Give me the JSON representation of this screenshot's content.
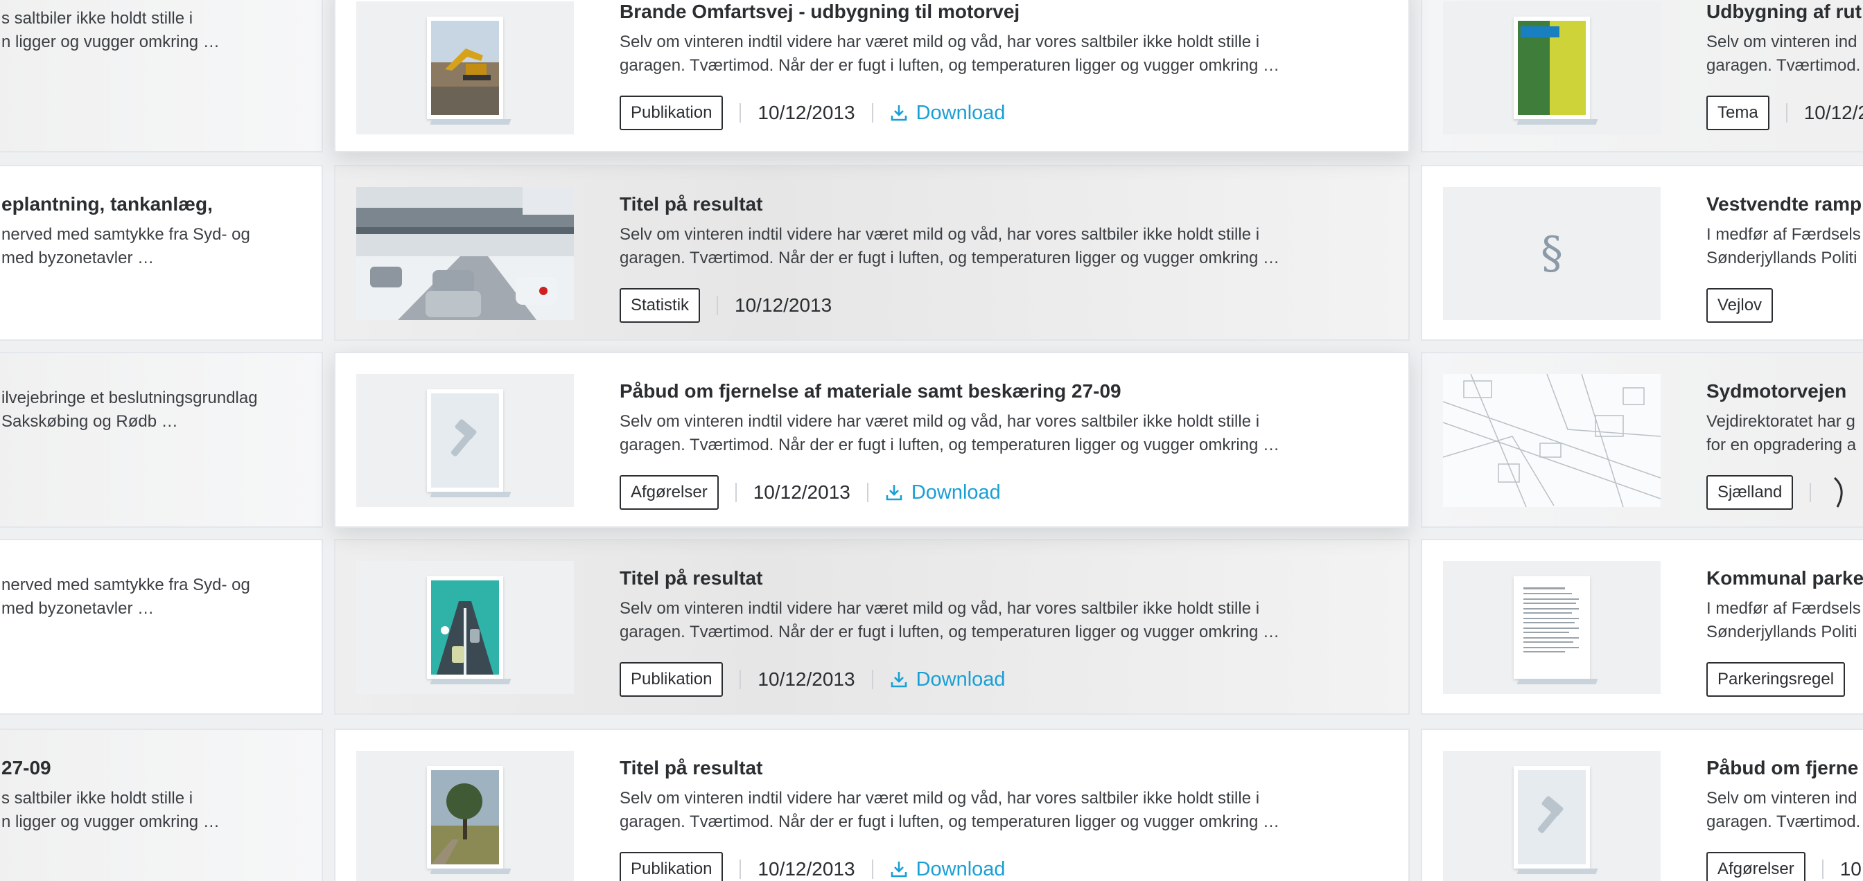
{
  "left_column": [
    {
      "title": "",
      "desc": [
        "s saltbiler ikke holdt stille i",
        "n ligger og vugger omkring …"
      ]
    },
    {
      "title": "eplantning, tankanlæg,",
      "desc": [
        "nerved med samtykke fra Syd- og",
        "med byzonetavler …"
      ]
    },
    {
      "title": "",
      "desc": [
        "ilvejebringe et beslutningsgrundlag",
        " Sakskøbing og Rødb …"
      ]
    },
    {
      "title": "",
      "desc": [
        "nerved med samtykke fra Syd- og",
        "med byzonetavler …"
      ]
    },
    {
      "title": " 27-09",
      "desc": [
        "s saltbiler ikke holdt stille i",
        "n ligger og vugger omkring …"
      ]
    }
  ],
  "center_column": [
    {
      "title": "Brande Omfartsvej - udbygning til motorvej",
      "desc": [
        "Selv om vinteren indtil videre har været mild og våd, har vores saltbiler ikke holdt stille i",
        "garagen. Tværtimod. Når der er fugt i luften, og temperaturen ligger og vugger omkring …"
      ],
      "tag": "Publikation",
      "date": "10/12/2013",
      "download": "Download",
      "thumb": "excavator-photo-icon"
    },
    {
      "title": "Titel på resultat",
      "desc": [
        "Selv om vinteren indtil videre har været mild og våd, har vores saltbiler ikke holdt stille i",
        "garagen. Tværtimod. Når der er fugt i luften, og temperaturen ligger og vugger omkring …"
      ],
      "tag": "Statistik",
      "date": "10/12/2013",
      "download": "",
      "thumb": "snowy-road-photo-icon"
    },
    {
      "title": "Påbud om fjernelse af materiale samt beskæring 27-09",
      "desc": [
        "Selv om vinteren indtil videre har været mild og våd, har vores saltbiler ikke holdt stille i",
        "garagen. Tværtimod. Når der er fugt i luften, og temperaturen ligger og vugger omkring …"
      ],
      "tag": "Afgørelser",
      "date": "10/12/2013",
      "download": "Download",
      "thumb": "gavel-icon"
    },
    {
      "title": "Titel på resultat",
      "desc": [
        "Selv om vinteren indtil videre har været mild og våd, har vores saltbiler ikke holdt stille i",
        "garagen. Tværtimod. Når der er fugt i luften, og temperaturen ligger og vugger omkring …"
      ],
      "tag": "Publikation",
      "date": "10/12/2013",
      "download": "Download",
      "thumb": "road-illustration-icon"
    },
    {
      "title": "Titel på resultat",
      "desc": [
        "Selv om vinteren indtil videre har været mild og våd, har vores saltbiler ikke holdt stille i",
        "garagen. Tværtimod. Når der er fugt i luften, og temperaturen ligger og vugger omkring …"
      ],
      "tag": "Publikation",
      "date": "10/12/2013",
      "download": "Download",
      "thumb": "tree-photo-icon"
    }
  ],
  "right_column": [
    {
      "title": "Udbygning af rut",
      "desc": [
        "Selv om vinteren ind",
        "garagen. Tværtimod."
      ],
      "tag": "Tema",
      "date": "10/12/2",
      "thumb": "field-map-icon"
    },
    {
      "title": "Vestvendte ramp",
      "desc": [
        "I medfør af Færdsels",
        "Sønderjyllands Politi"
      ],
      "tag": "Vejlov",
      "date": "",
      "thumb": "paragraph-icon",
      "para": "§"
    },
    {
      "title": "Sydmotorvejen",
      "desc": [
        "Vejdirektoratet har g",
        "for en opgradering a"
      ],
      "tag": "Sjælland",
      "date": "",
      "thumb": "street-map-icon"
    },
    {
      "title": "Kommunal parke",
      "desc": [
        "I medfør af Færdsels",
        "Sønderjyllands Politi"
      ],
      "tag": "Parkeringsregel",
      "date": "",
      "thumb": "document-icon"
    },
    {
      "title": "Påbud om fjerne",
      "desc": [
        "Selv om vinteren ind",
        "garagen. Tværtimod."
      ],
      "tag": "Afgørelser",
      "date": "10",
      "thumb": "gavel-icon"
    }
  ],
  "colors": {
    "accent": "#1a9fd5",
    "text": "#2b2e31",
    "border": "#e3e6ea"
  }
}
